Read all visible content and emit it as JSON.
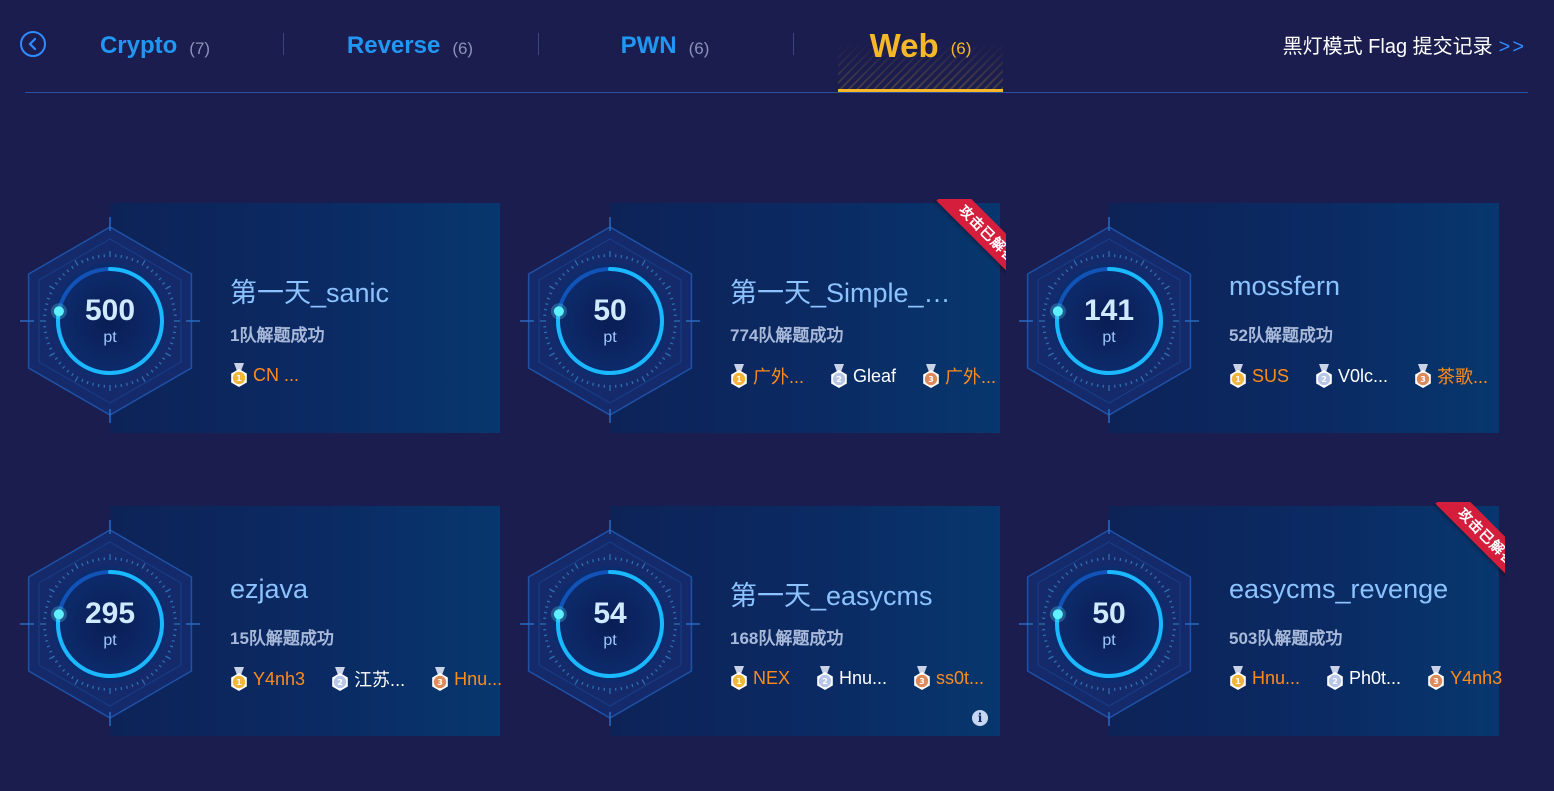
{
  "tabs": [
    {
      "name": "Crypto",
      "count": "(7)"
    },
    {
      "name": "Reverse",
      "count": "(6)"
    },
    {
      "name": "PWN",
      "count": "(6)"
    },
    {
      "name": "Web",
      "count": "(6)",
      "active": true
    }
  ],
  "flag_log": {
    "label": "黑灯模式 Flag 提交记录",
    "arrow": ">>"
  },
  "colors": {
    "accent": "#f6b826",
    "tab": "#2196f3",
    "ribbon": "#d41e3c",
    "first_blood": "#ff8c1a"
  },
  "point_unit": "pt",
  "solved_ribbon_text": "攻击已解答",
  "challenges": [
    {
      "title": "第一天_sanic",
      "points": "500",
      "progress": 0.78,
      "solves": "1队解题成功",
      "bloods": [
        {
          "rank": "1",
          "name": "CN ..."
        }
      ],
      "solved": false
    },
    {
      "title": "第一天_Simple_…",
      "points": "50",
      "progress": 0.78,
      "solves": "774队解题成功",
      "bloods": [
        {
          "rank": "1",
          "name": "广外..."
        },
        {
          "rank": "2",
          "name": "Gleaf"
        },
        {
          "rank": "3",
          "name": "广外..."
        }
      ],
      "solved": true
    },
    {
      "title": "mossfern",
      "points": "141",
      "progress": 0.78,
      "solves": "52队解题成功",
      "bloods": [
        {
          "rank": "1",
          "name": "SUS"
        },
        {
          "rank": "2",
          "name": "V0lc..."
        },
        {
          "rank": "3",
          "name": "茶歌..."
        }
      ],
      "solved": false
    },
    {
      "title": "ezjava",
      "points": "295",
      "progress": 0.78,
      "solves": "15队解题成功",
      "bloods": [
        {
          "rank": "1",
          "name": "Y4nh3"
        },
        {
          "rank": "2",
          "name": "江苏..."
        },
        {
          "rank": "3",
          "name": "Hnu..."
        }
      ],
      "solved": false
    },
    {
      "title": "第一天_easycms",
      "points": "54",
      "progress": 0.78,
      "solves": "168队解题成功",
      "bloods": [
        {
          "rank": "1",
          "name": "NEX"
        },
        {
          "rank": "2",
          "name": "Hnu..."
        },
        {
          "rank": "3",
          "name": "ss0t..."
        }
      ],
      "solved": false,
      "info": "i"
    },
    {
      "title": "easycms_revenge",
      "points": "50",
      "progress": 0.78,
      "solves": "503队解题成功",
      "bloods": [
        {
          "rank": "1",
          "name": "Hnu..."
        },
        {
          "rank": "2",
          "name": "Ph0t..."
        },
        {
          "rank": "3",
          "name": "Y4nh3"
        }
      ],
      "solved": true
    }
  ]
}
